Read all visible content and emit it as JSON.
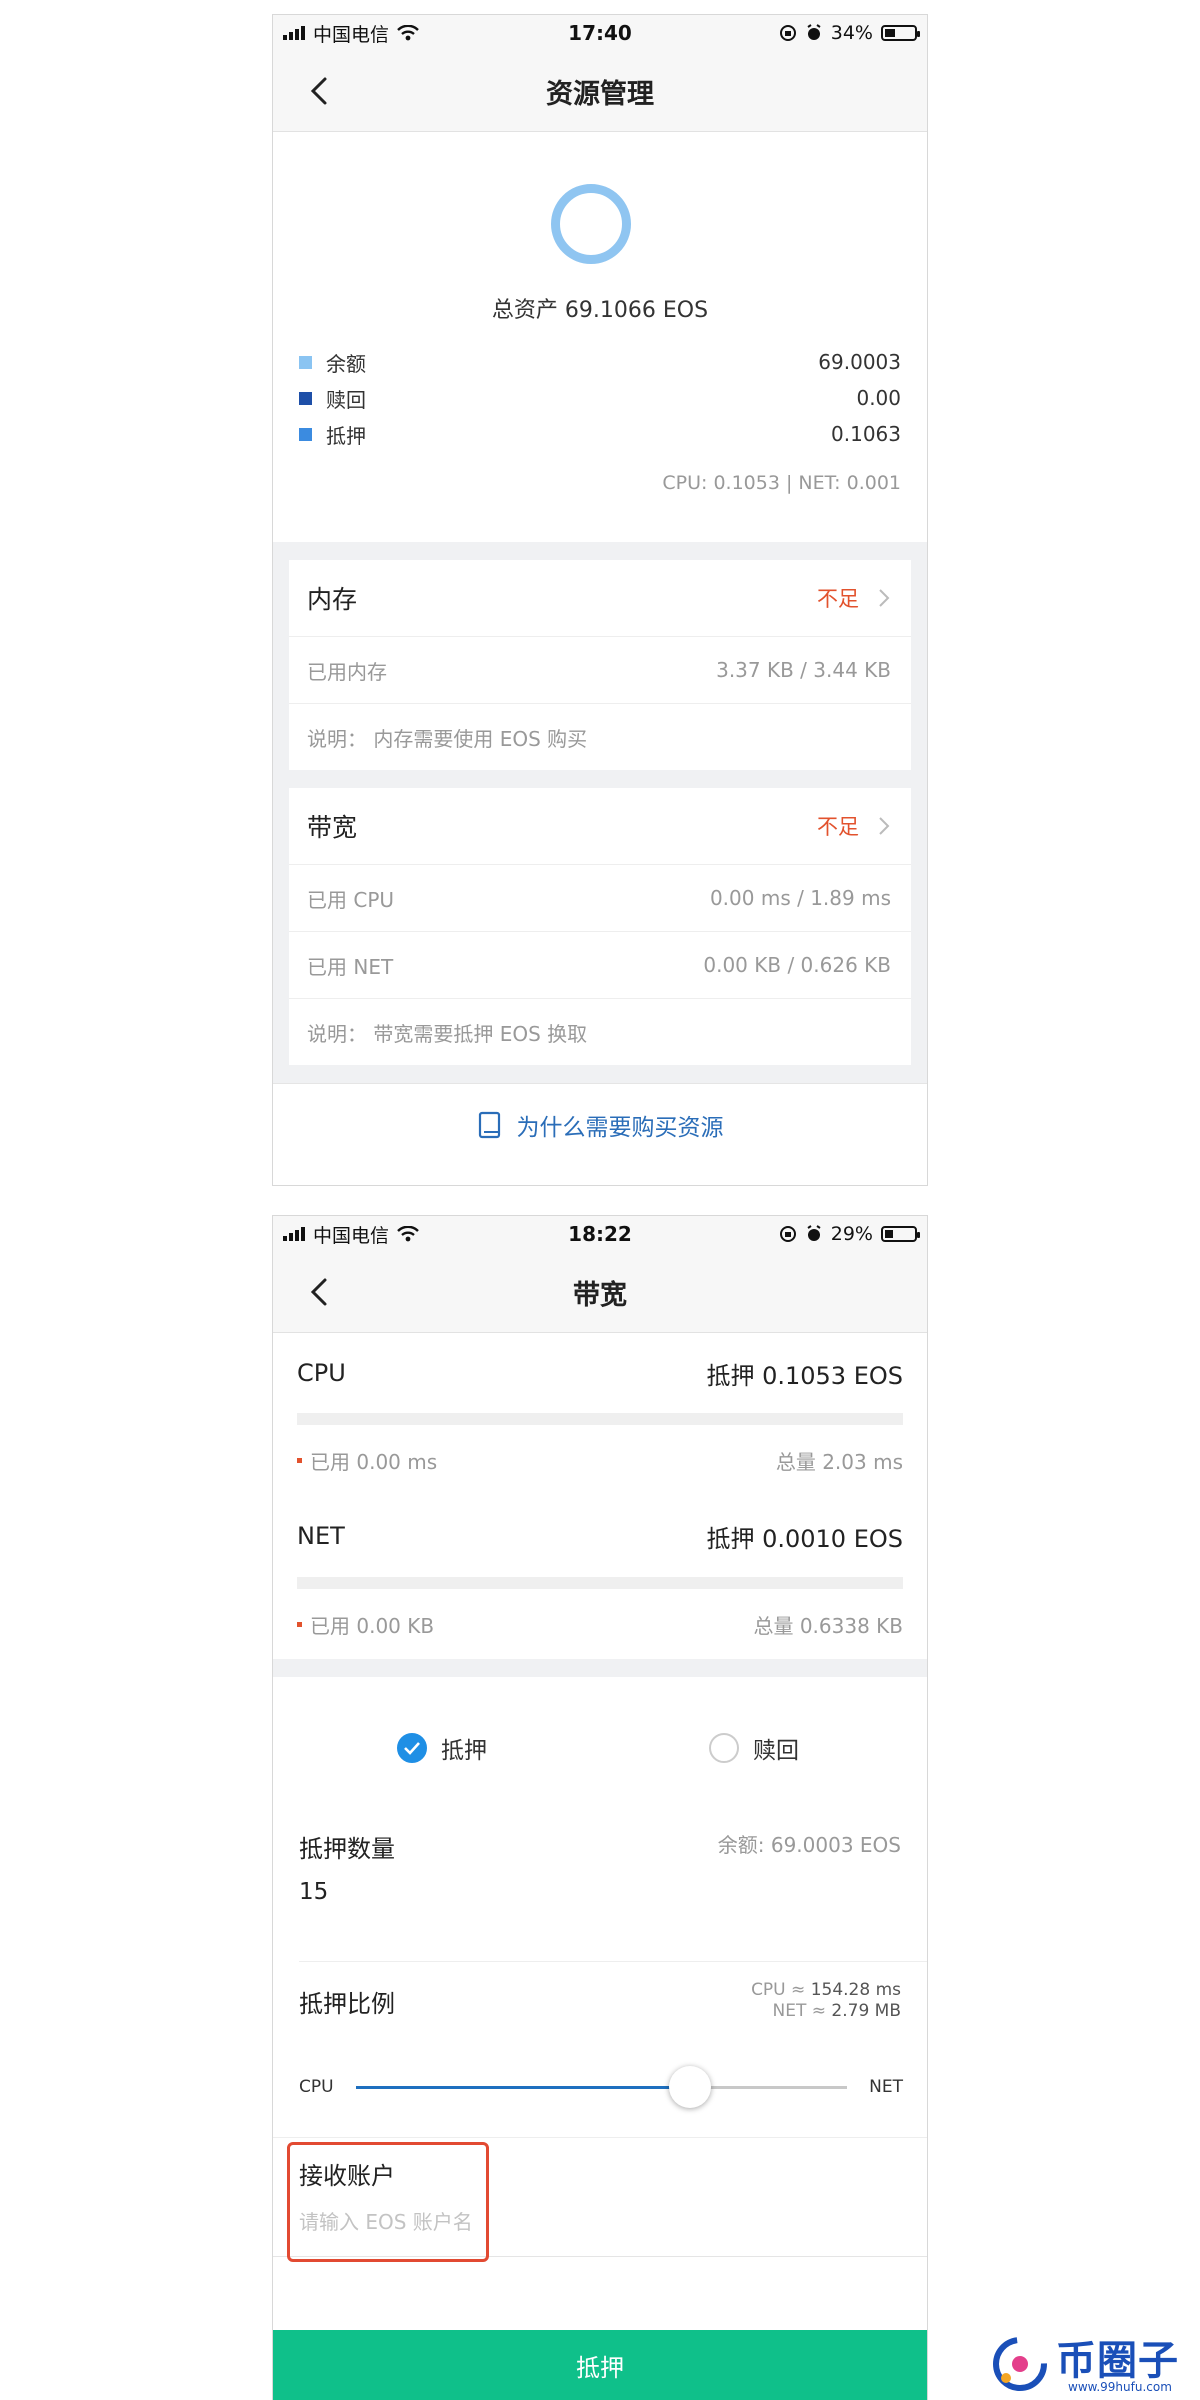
{
  "screen1": {
    "status": {
      "carrier": "中国电信",
      "time": "17:40",
      "battery": "34%",
      "battery_level": 0.34
    },
    "nav": {
      "title": "资源管理",
      "back_icon": "chevron-left-icon"
    },
    "summary": {
      "total_label": "总资产 69.1066 EOS",
      "ring_color": "#8fc5f1",
      "legend": [
        {
          "label": "余额",
          "value": "69.0003",
          "color": "#8ac4f2"
        },
        {
          "label": "赎回",
          "value": "0.00",
          "color": "#1e4fa8"
        },
        {
          "label": "抵押",
          "value": "0.1063",
          "color": "#3b8be0"
        }
      ],
      "breakdown": "CPU: 0.1053 | NET: 0.001"
    },
    "memory": {
      "title": "内存",
      "status": "不足",
      "rows": [
        {
          "label": "已用内存",
          "value": "3.37 KB / 3.44 KB"
        }
      ],
      "note": "说明： 内存需要使用 EOS 购买"
    },
    "bandwidth": {
      "title": "带宽",
      "status": "不足",
      "rows": [
        {
          "label": "已用 CPU",
          "value": "0.00 ms / 1.89 ms"
        },
        {
          "label": "已用 NET",
          "value": "0.00 KB / 0.626 KB"
        }
      ],
      "note": "说明： 带宽需要抵押 EOS 换取"
    },
    "why_link": "为什么需要购买资源",
    "accent_color": "#e2522d",
    "link_color": "#2a6db8"
  },
  "screen2": {
    "status": {
      "carrier": "中国电信",
      "time": "18:22",
      "battery": "29%",
      "battery_level": 0.29
    },
    "nav": {
      "title": "带宽",
      "back_icon": "chevron-left-icon"
    },
    "cpu": {
      "name": "CPU",
      "stake": "抵押 0.1053 EOS",
      "used": "已用 0.00 ms",
      "total": "总量 2.03 ms",
      "used_fraction": 0
    },
    "net": {
      "name": "NET",
      "stake": "抵押 0.0010 EOS",
      "used": "已用 0.00 KB",
      "total": "总量 0.6338 KB",
      "used_fraction": 0
    },
    "mode": {
      "stake": "抵押",
      "redeem": "赎回",
      "selected": "抵押"
    },
    "amount": {
      "label": "抵押数量",
      "balance": "余额: 69.0003 EOS",
      "value": "15"
    },
    "ratio": {
      "label": "抵押比例",
      "cpu_est_prefix": "CPU ≈",
      "cpu_est": "154.28 ms",
      "net_est_prefix": "NET ≈",
      "net_est": "2.79 MB",
      "left": "CPU",
      "right": "NET",
      "cpu_fraction": 0.68
    },
    "receiver": {
      "label": "接收账户",
      "placeholder": "请输入 EOS 账户名",
      "value": ""
    },
    "submit": "抵押",
    "submit_color": "#0fc08a",
    "selected_color": "#1f8fe5"
  },
  "watermark": {
    "title": "币圈子",
    "url": "www.99hufu.com"
  }
}
